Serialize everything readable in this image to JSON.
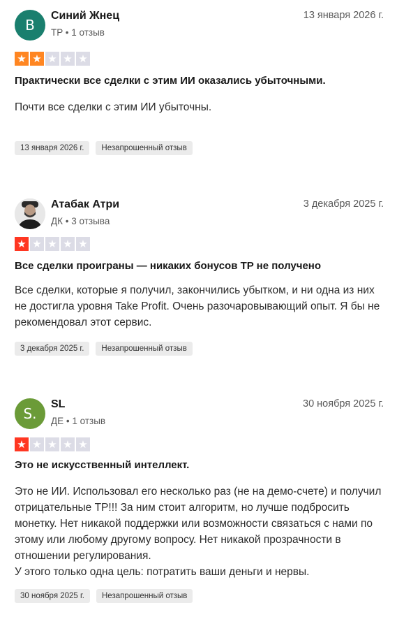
{
  "reviews": [
    {
      "avatar_letter": "В",
      "avatar_color": "#1a7f6e",
      "name": "Синий Жнец",
      "country": "TP",
      "review_count": "1 отзыв",
      "date": "13 января 2026 г.",
      "rating": 2,
      "title": "Практически все сделки с этим ИИ оказались убыточными.",
      "body": "Почти все сделки с этим ИИ убыточны.",
      "tag_date": "13 января 2026 г.",
      "tag_type": "Незапрошенный отзыв"
    },
    {
      "avatar_letter": "",
      "avatar_color": "#d9d9d9",
      "name": "Атабак Атри",
      "country": "ДК",
      "review_count": "3 отзыва",
      "date": "3 декабря 2025 г.",
      "rating": 1,
      "title": "Все сделки проиграны — никаких бонусов TP не получено",
      "body": "Все сделки, которые я получил, закончились убытком, и ни одна из них не достигла уровня Take Profit. Очень разочаровывающий опыт. Я бы не рекомендовал этот сервис.",
      "tag_date": "3 декабря 2025 г.",
      "tag_type": "Незапрошенный отзыв"
    },
    {
      "avatar_letter": "S.",
      "avatar_color": "#6b9b38",
      "name": "SL",
      "country": "ДЕ",
      "review_count": "1 отзыв",
      "date": "30 ноября 2025 г.",
      "rating": 1,
      "title": "Это не искусственный интеллект.",
      "body": "Это не ИИ. Использовал его несколько раз (не на демо-счете) и получил отрицательные TP!!! За ним стоит алгоритм, но лучше подбросить монетку. Нет никакой поддержки или возможности связаться с нами по этому или любому другому вопросу. Нет никакой прозрачности в отношении регулирования.\nУ этого только одна цель: потратить ваши деньги и нервы.",
      "tag_date": "30 ноября 2025 г.",
      "tag_type": "Незапрошенный отзыв"
    }
  ],
  "separator": " • ",
  "star_glyph": "★",
  "colors": {
    "star_two": "#ff8622",
    "star_one": "#ff3722",
    "star_empty": "#dcdce6"
  }
}
